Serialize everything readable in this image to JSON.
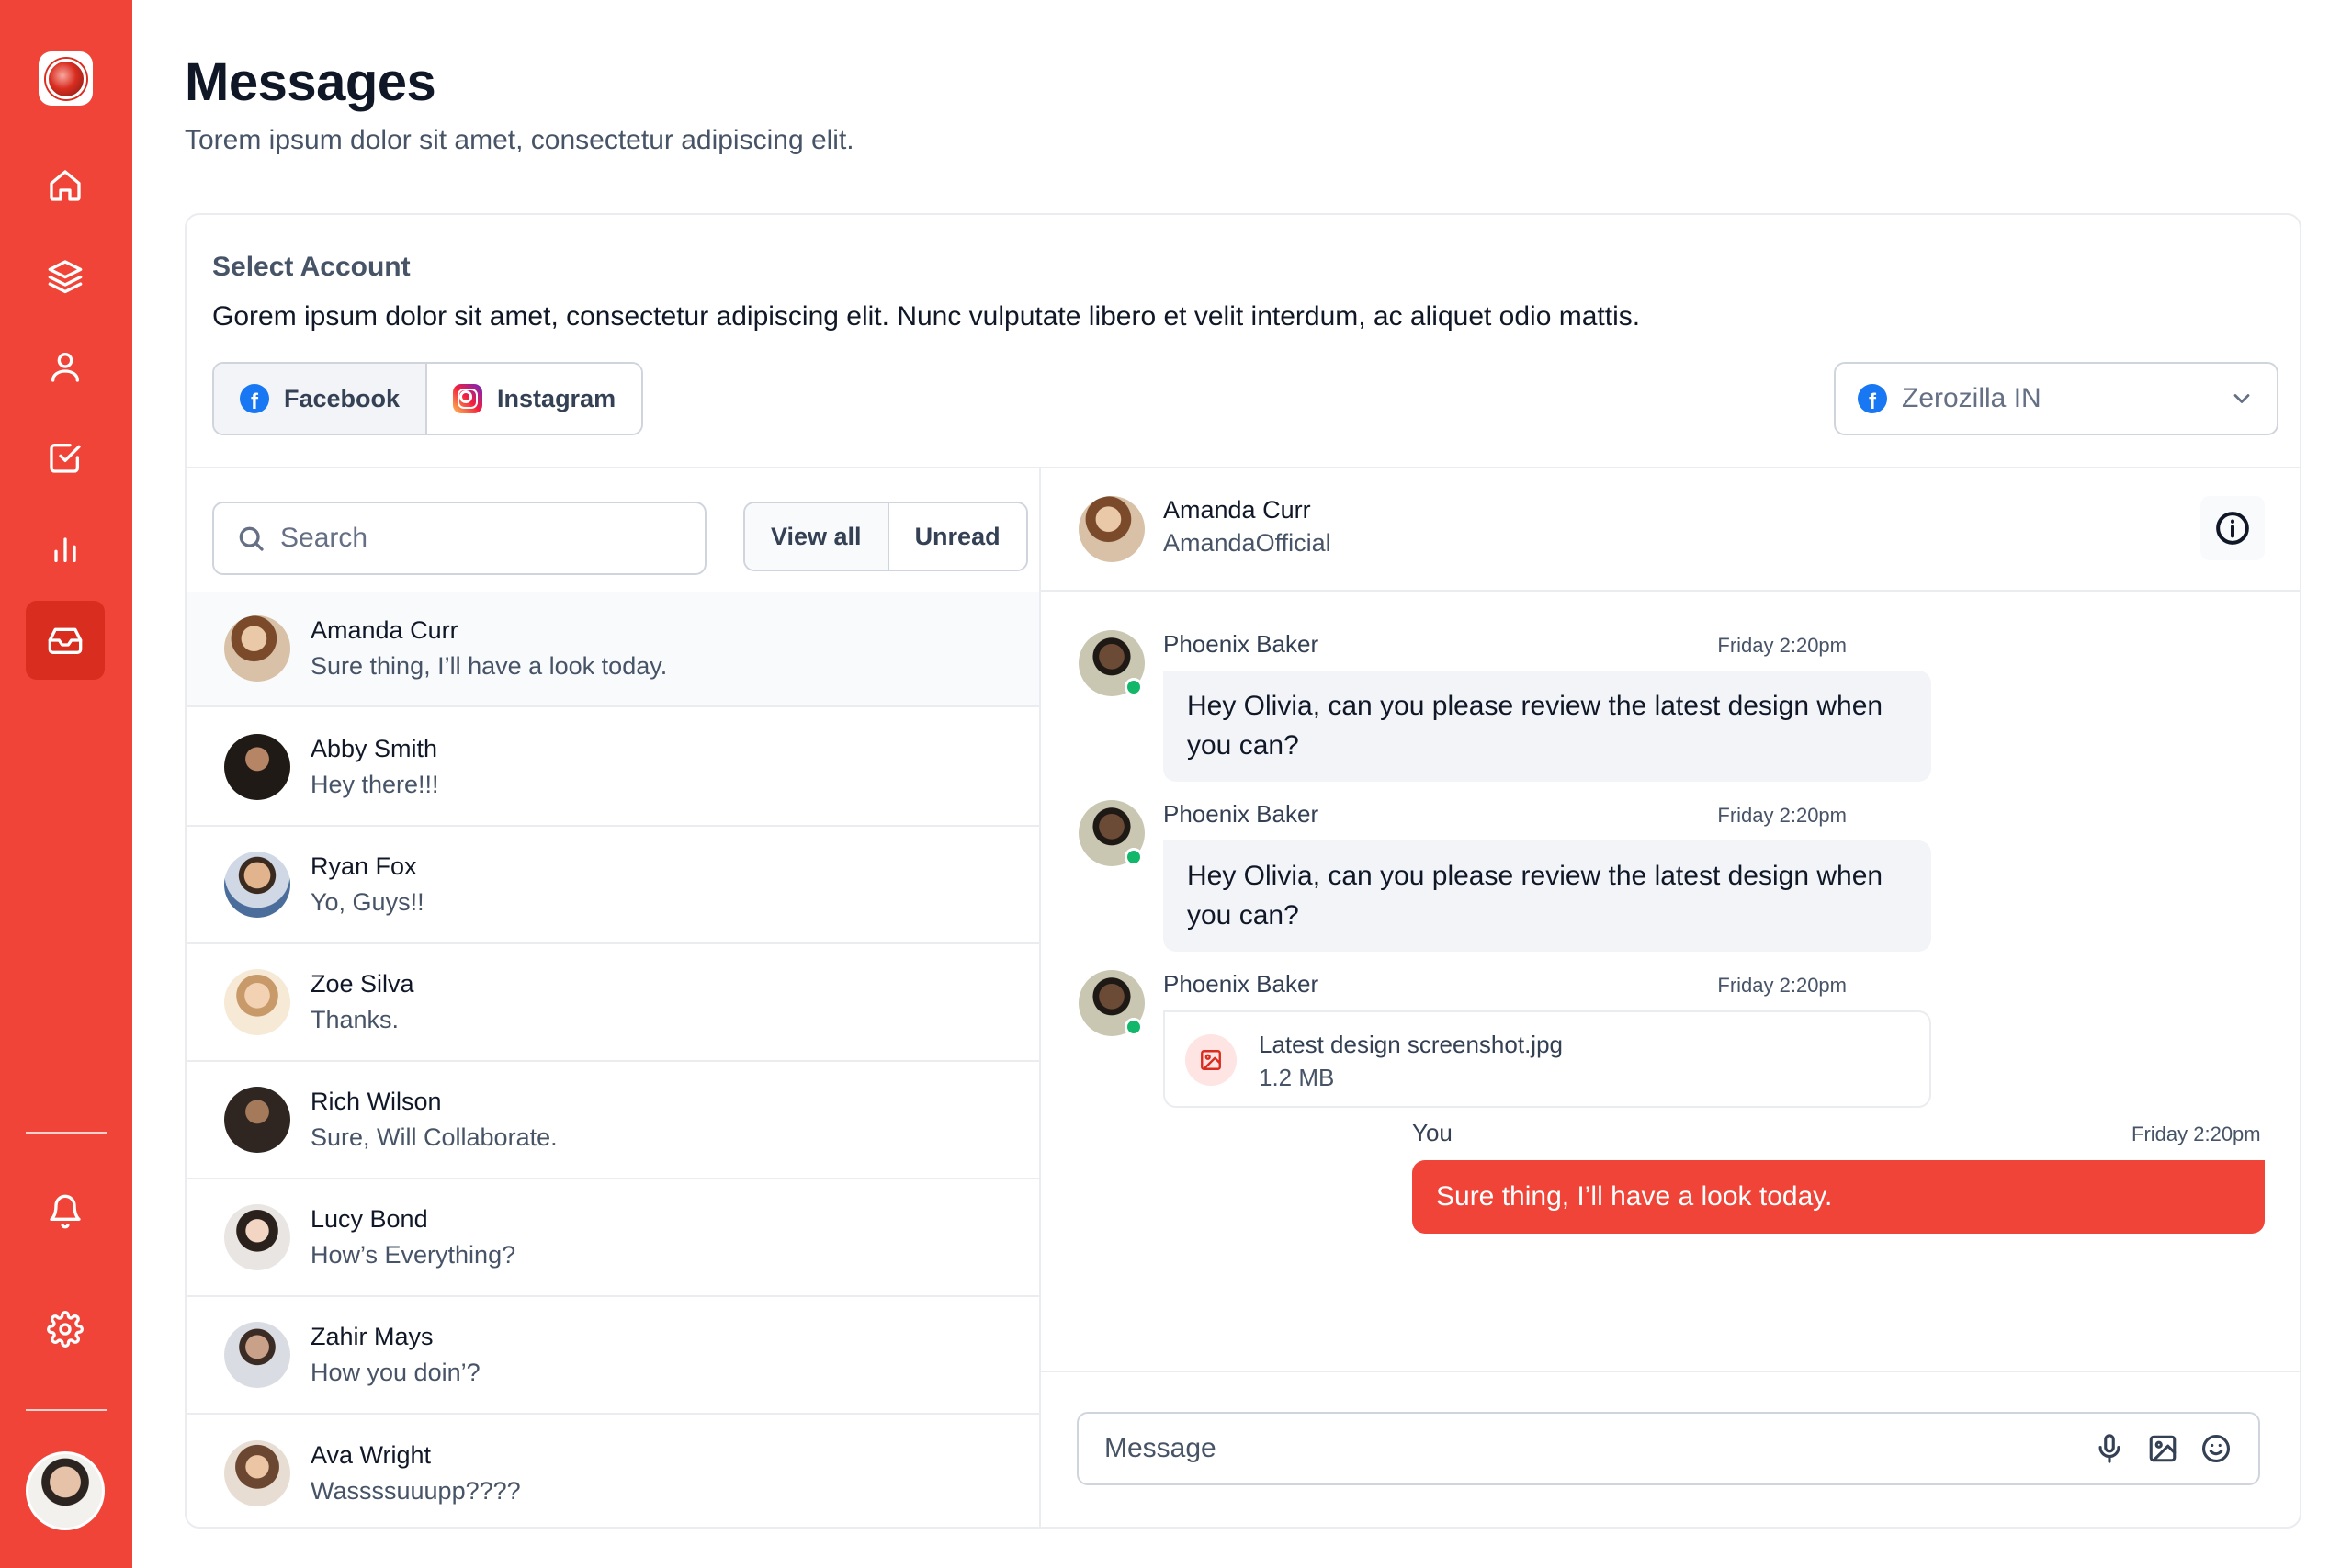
{
  "sidebar": {
    "logo": "app-logo",
    "nav": [
      {
        "name": "home-icon",
        "active": false
      },
      {
        "name": "layers-icon",
        "active": false
      },
      {
        "name": "user-icon",
        "active": false
      },
      {
        "name": "check-square-icon",
        "active": false
      },
      {
        "name": "bar-chart-icon",
        "active": false
      },
      {
        "name": "inbox-icon",
        "active": true
      }
    ],
    "bottom": [
      "bell-icon",
      "settings-icon",
      "user-avatar"
    ],
    "accent": "#F04438"
  },
  "header": {
    "title": "Messages",
    "subtitle": "Torem ipsum dolor sit amet, consectetur adipiscing elit."
  },
  "account": {
    "label": "Select Account",
    "description": "Gorem ipsum dolor sit amet, consectetur adipiscing elit. Nunc vulputate libero et velit interdum, ac aliquet odio mattis.",
    "platforms": [
      {
        "label": "Facebook",
        "icon": "facebook-icon",
        "selected": true
      },
      {
        "label": "Instagram",
        "icon": "instagram-icon",
        "selected": false
      }
    ],
    "selected_account": "Zerozilla IN"
  },
  "list": {
    "search_placeholder": "Search",
    "filters": [
      "View all",
      "Unread"
    ],
    "conversations": [
      {
        "name": "Amanda Curr",
        "preview": "Sure thing, I’ll have a look today.",
        "active": true
      },
      {
        "name": "Abby Smith",
        "preview": "Hey there!!!"
      },
      {
        "name": "Ryan Fox",
        "preview": "Yo, Guys!!"
      },
      {
        "name": "Zoe Silva",
        "preview": "Thanks."
      },
      {
        "name": "Rich Wilson",
        "preview": "Sure, Will Collaborate."
      },
      {
        "name": "Lucy Bond",
        "preview": "How’s Everything?"
      },
      {
        "name": "Zahir Mays",
        "preview": "How you doin’?"
      },
      {
        "name": "Ava Wright",
        "preview": "Wassssuuupp????"
      }
    ]
  },
  "chat": {
    "contact_name": "Amanda Curr",
    "contact_handle": "AmandaOfficial",
    "messages": [
      {
        "sender": "Phoenix Baker",
        "time": "Friday 2:20pm",
        "text": "Hey Olivia, can you please review the latest design when you can?"
      },
      {
        "sender": "Phoenix Baker",
        "time": "Friday 2:20pm",
        "text": "Hey Olivia, can you please review the latest design when you can?"
      },
      {
        "sender": "Phoenix Baker",
        "time": "Friday 2:20pm",
        "file_name": "Latest design screenshot.jpg",
        "file_size": "1.2 MB"
      }
    ],
    "own_message": {
      "sender": "You",
      "time": "Friday 2:20pm",
      "text": "Sure thing, I’ll have a look today."
    },
    "composer_placeholder": "Message"
  }
}
